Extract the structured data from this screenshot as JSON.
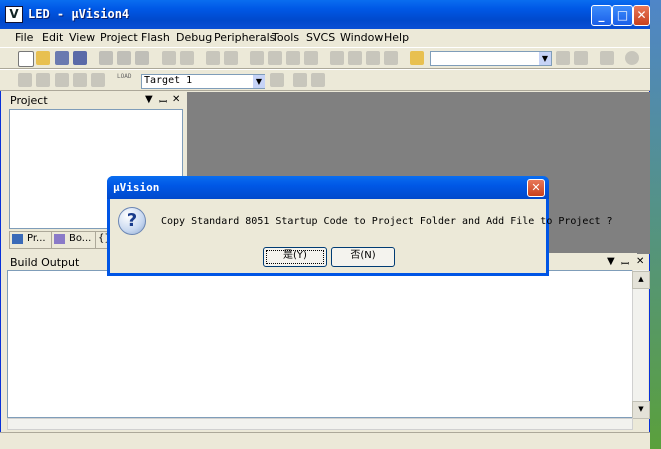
{
  "window": {
    "title": "LED  - µVision4",
    "logo": "V"
  },
  "menu": [
    "File",
    "Edit",
    "View",
    "Project",
    "Flash",
    "Debug",
    "Peripherals",
    "Tools",
    "SVCS",
    "Window",
    "Help"
  ],
  "toolbar": {
    "target": "Target 1",
    "load_label": "LOAD"
  },
  "project_pane": {
    "title": "Project",
    "tabs": [
      "Pr...",
      "Bo...",
      "{}"
    ]
  },
  "build_output": {
    "title": "Build Output"
  },
  "pane_controls": {
    "menu": "▼",
    "pin": "ꟷ",
    "close": "✕"
  },
  "dialog": {
    "title": "µVision",
    "icon": "question-icon",
    "icon_glyph": "?",
    "message": "Copy Standard 8051 Startup Code to Project Folder and Add File to Project ?",
    "yes_label": "是(Y)",
    "no_label": "否(N)"
  },
  "colors": {
    "titlebar": "#0058e6",
    "workspace": "#808080",
    "chrome": "#ece9d8"
  }
}
